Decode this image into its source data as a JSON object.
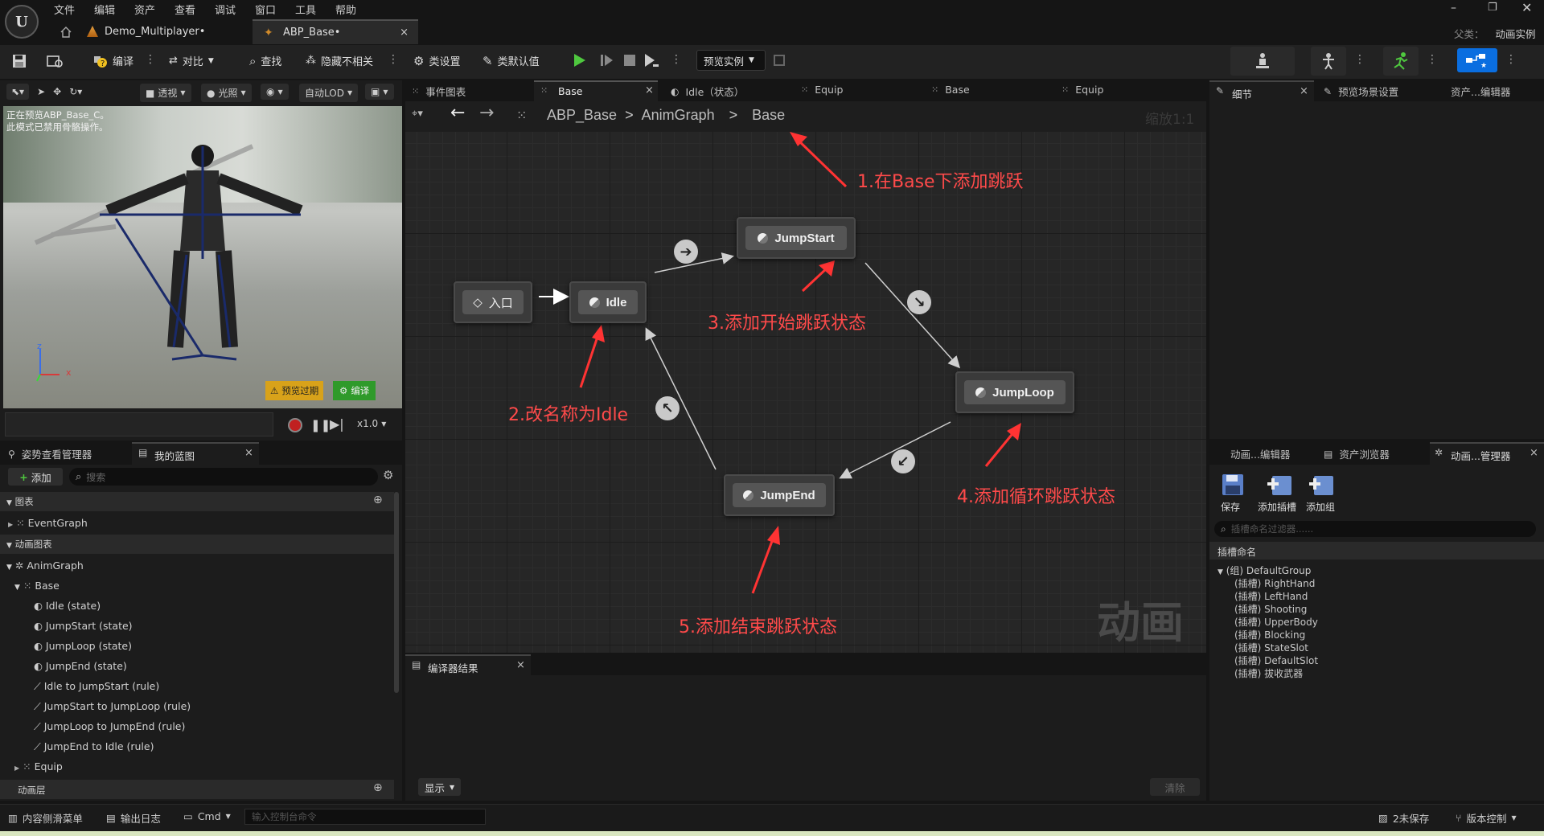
{
  "app": {
    "logo": "U"
  },
  "menu": [
    "文件",
    "编辑",
    "资产",
    "查看",
    "调试",
    "窗口",
    "工具",
    "帮助"
  ],
  "doc_tabs": [
    {
      "label": "Demo_Multiplayer•"
    },
    {
      "label": "ABP_Base•"
    }
  ],
  "parent_class": {
    "label": "父类：",
    "value": "动画实例"
  },
  "toolbar": {
    "compile": "编译",
    "diff": "对比",
    "find": "查找",
    "hide_unrelated": "隐藏不相关",
    "class_settings": "类设置",
    "class_defaults": "类默认值",
    "preview_instance": "预览实例"
  },
  "viewport": {
    "buttons": [
      "透视",
      "光照",
      "自动LOD"
    ],
    "overlay_text": "正在预览ABP_Base_C。\n此模式已禁用骨骼操作。",
    "preview_expired": "预览过期",
    "compile": "编译",
    "speed": "x1.0",
    "axis_z": "z",
    "axis_x": "x"
  },
  "left_tabs": {
    "pose_manager": "姿势查看管理器",
    "my_blueprint": "我的蓝图"
  },
  "my_blueprint": {
    "add": "添加",
    "search_placeholder": "搜索",
    "graphs_header": "图表",
    "event_graph": "EventGraph",
    "anim_graphs_header": "动画图表",
    "anim_graph": "AnimGraph",
    "base": "Base",
    "items": [
      "Idle (state)",
      "JumpStart (state)",
      "JumpLoop (state)",
      "JumpEnd (state)",
      "Idle to JumpStart (rule)",
      "JumpStart to JumpLoop (rule)",
      "JumpLoop to JumpEnd (rule)",
      "JumpEnd to Idle (rule)"
    ],
    "equip": "Equip",
    "anim_layers": "动画层"
  },
  "graph_tabs": [
    "事件图表",
    "Base",
    "Idle（状态）",
    "Equip",
    "Base",
    "Equip"
  ],
  "breadcrumb": {
    "items": [
      "ABP_Base",
      "AnimGraph",
      "Base"
    ],
    "zoom": "缩放1:1"
  },
  "graph": {
    "entry": "入口",
    "nodes": {
      "idle": "Idle",
      "jump_start": "JumpStart",
      "jump_loop": "JumpLoop",
      "jump_end": "JumpEnd"
    },
    "watermark": "动画",
    "annotations": [
      "1.在Base下添加跳跃",
      "2.改名称为Idle",
      "3.添加开始跳跃状态",
      "4.添加循环跳跃状态",
      "5.添加结束跳跃状态"
    ]
  },
  "compiler_results": {
    "tab": "编译器结果",
    "show": "显示",
    "clear": "清除"
  },
  "right_tabs": {
    "details": "细节",
    "preview_scene": "预览场景设置",
    "asset_editor": "资产...编辑器"
  },
  "right_bottom_tabs": {
    "anim_editor": "动画...编辑器",
    "asset_browser": "资产浏览器",
    "anim_manager": "动画...管理器"
  },
  "slot_manager": {
    "save": "保存",
    "add_slot": "添加插槽",
    "add_group": "添加组",
    "filter_placeholder": "插槽命名过滤器......",
    "header": "插槽命名",
    "group": "(组) DefaultGroup",
    "slots": [
      "(插槽) RightHand",
      "(插槽) LeftHand",
      "(插槽) Shooting",
      "(插槽) UpperBody",
      "(插槽) Blocking",
      "(插槽) StateSlot",
      "(插槽) DefaultSlot",
      "(插槽) 拔收武器"
    ]
  },
  "statusbar": {
    "content_drawer": "内容侧滑菜单",
    "output_log": "输出日志",
    "cmd": "Cmd",
    "console_placeholder": "输入控制台命令",
    "unsaved": "2未保存",
    "source_control": "版本控制"
  }
}
